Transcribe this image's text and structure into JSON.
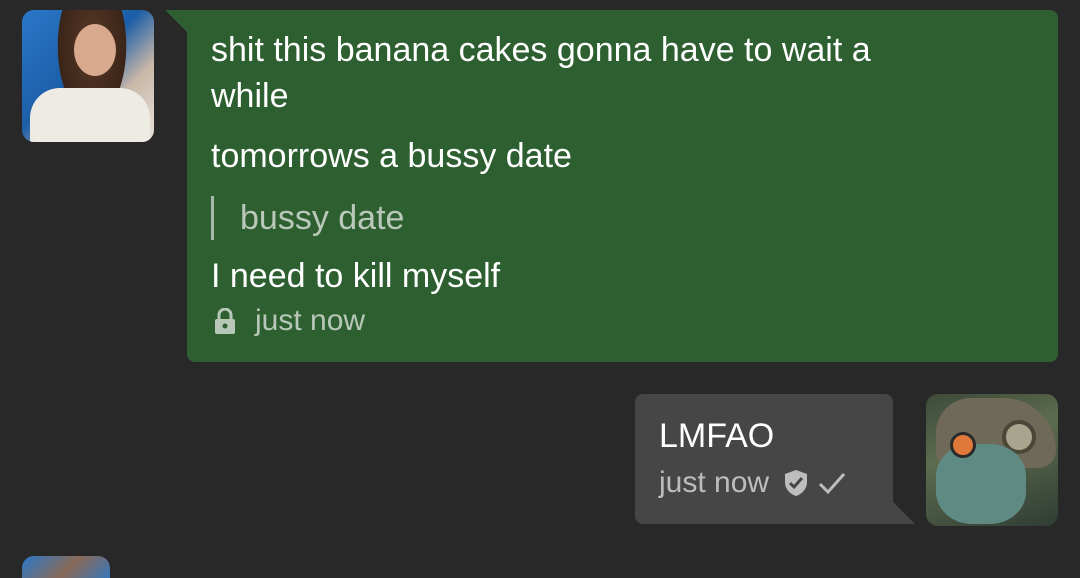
{
  "incoming": {
    "messages": [
      "shit this banana cakes gonna have to wait a",
      "while",
      "tomorrows a bussy date",
      "I need to kill myself"
    ],
    "quote": "bussy date",
    "time": "just now",
    "bubble_color": "#2d5f30",
    "icon": "lock-icon"
  },
  "outgoing": {
    "text": "LMFAO",
    "time": "just now",
    "bubble_color": "#464646",
    "icons": [
      "shield-check-icon",
      "checkmark-icon"
    ]
  }
}
